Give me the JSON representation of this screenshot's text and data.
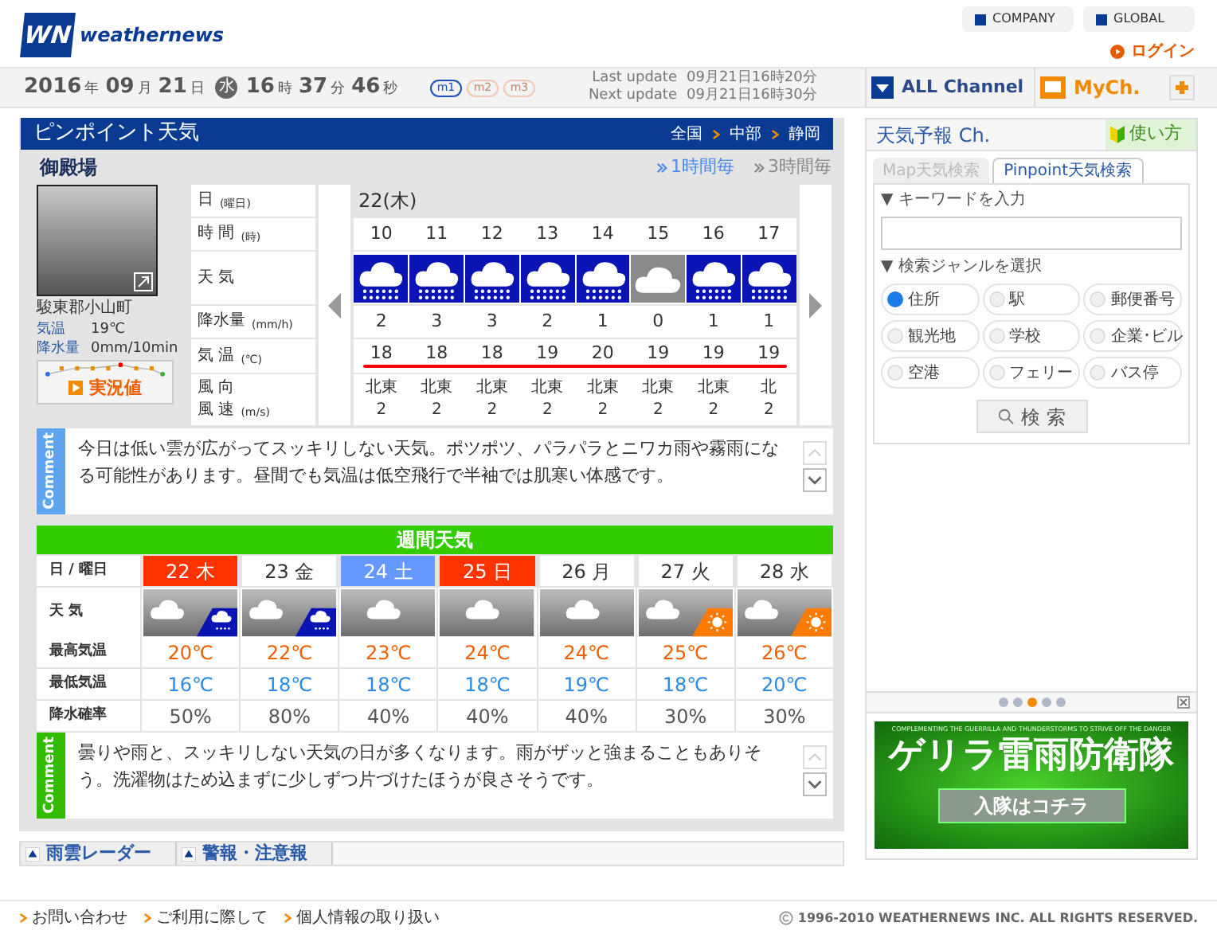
{
  "header": {
    "logo_mark": "WN",
    "logo_text": "weathernews",
    "links": [
      "COMPANY",
      "GLOBAL"
    ],
    "login": "ログイン"
  },
  "clock": {
    "parts": [
      {
        "kind": "num",
        "text": "2016"
      },
      {
        "kind": "unit",
        "text": "年"
      },
      {
        "kind": "num",
        "text": "09"
      },
      {
        "kind": "unit",
        "text": "月"
      },
      {
        "kind": "num",
        "text": "21"
      },
      {
        "kind": "unit",
        "text": "日"
      },
      {
        "kind": "badge",
        "text": "水"
      },
      {
        "kind": "num",
        "text": "16"
      },
      {
        "kind": "unit",
        "text": "時"
      },
      {
        "kind": "num",
        "text": "37"
      },
      {
        "kind": "unit",
        "text": "分"
      },
      {
        "kind": "num",
        "text": "46"
      },
      {
        "kind": "unit",
        "text": "秒"
      }
    ],
    "modes": [
      {
        "label": "m1",
        "selected": true
      },
      {
        "label": "m2",
        "selected": false
      },
      {
        "label": "m3",
        "selected": false
      }
    ]
  },
  "updates": [
    {
      "label": "Last update",
      "value": "09月21日16時20分"
    },
    {
      "label": "Next update",
      "value": "09月21日16時30分"
    }
  ],
  "channels": {
    "all": "ALL Channel",
    "my": "MyCh."
  },
  "pinpoint": {
    "title": "ピンポイント天気",
    "breadcrumb": [
      "全国",
      "中部",
      "静岡"
    ],
    "location": "御殿場",
    "periods": [
      {
        "label": "1時間毎",
        "selected": true
      },
      {
        "label": "3時間毎",
        "selected": false
      }
    ],
    "camera": {
      "place": "駿東郡小山町",
      "readings": [
        {
          "label": "気温",
          "value": "19℃"
        },
        {
          "label": "降水量",
          "value": "0mm/10min"
        }
      ],
      "button": "実況値"
    },
    "hourly": {
      "row_labels": [
        {
          "lines": [
            "日"
          ],
          "unit": "(曜日)"
        },
        {
          "lines": [
            "時 間"
          ],
          "unit": "(時)"
        },
        {
          "lines": [
            "天 気"
          ]
        },
        {
          "lines": [
            "降水量"
          ],
          "unit": "(mm/h)"
        },
        {
          "lines": [
            "気 温"
          ],
          "unit": "(℃)"
        },
        {
          "lines": [
            "風 向",
            "風 速"
          ],
          "unit": "(m/s)"
        }
      ],
      "date": "22(木)",
      "hours": [
        {
          "time": "10",
          "kind": "rain",
          "precip": "2",
          "temp": "18",
          "wind_dir": "北東",
          "wind_speed": "2"
        },
        {
          "time": "11",
          "kind": "rain",
          "precip": "3",
          "temp": "18",
          "wind_dir": "北東",
          "wind_speed": "2"
        },
        {
          "time": "12",
          "kind": "rain",
          "precip": "3",
          "temp": "18",
          "wind_dir": "北東",
          "wind_speed": "2"
        },
        {
          "time": "13",
          "kind": "rain",
          "precip": "2",
          "temp": "19",
          "wind_dir": "北東",
          "wind_speed": "2"
        },
        {
          "time": "14",
          "kind": "rain",
          "precip": "1",
          "temp": "20",
          "wind_dir": "北東",
          "wind_speed": "2"
        },
        {
          "time": "15",
          "kind": "cloudy",
          "precip": "0",
          "temp": "19",
          "wind_dir": "北東",
          "wind_speed": "2"
        },
        {
          "time": "16",
          "kind": "rain",
          "precip": "1",
          "temp": "19",
          "wind_dir": "北東",
          "wind_speed": "2"
        },
        {
          "time": "17",
          "kind": "rain",
          "precip": "1",
          "temp": "19",
          "wind_dir": "北",
          "wind_speed": "2"
        }
      ]
    },
    "comment": {
      "tag": "Comment",
      "text": "今日は低い雲が広がってスッキリしない天気。ポツポツ、パラパラとニワカ雨や霧雨になる可能性があります。昼間でも気温は低空飛行で半袖では肌寒い体感です。"
    }
  },
  "weekly": {
    "title": "週間天気",
    "row_labels": [
      "日 / 曜日",
      "天 気",
      "最高気温",
      "最低気温",
      "降水確率"
    ],
    "days": [
      {
        "day": "22 木",
        "color": "#ff3300",
        "kind": "cloudy-rain",
        "high": "20℃",
        "low": "16℃",
        "pop": "50%"
      },
      {
        "day": "23 金",
        "kind": "cloudy-rain",
        "high": "22℃",
        "low": "18℃",
        "pop": "80%"
      },
      {
        "day": "24 土",
        "color": "#6699ff",
        "kind": "cloudy",
        "high": "23℃",
        "low": "18℃",
        "pop": "40%"
      },
      {
        "day": "25 日",
        "color": "#ff3300",
        "kind": "cloudy",
        "high": "24℃",
        "low": "18℃",
        "pop": "40%"
      },
      {
        "day": "26 月",
        "kind": "cloudy",
        "high": "24℃",
        "low": "19℃",
        "pop": "40%"
      },
      {
        "day": "27 火",
        "kind": "cloudy-sun",
        "high": "25℃",
        "low": "18℃",
        "pop": "30%"
      },
      {
        "day": "28 水",
        "kind": "cloudy-sun",
        "high": "26℃",
        "low": "20℃",
        "pop": "30%"
      }
    ],
    "comment": {
      "tag": "Comment",
      "text": "曇りや雨と、スッキリしない天気の日が多くなります。雨がザッと強まることもありそう。洗濯物はため込まずに少しずつ片づけたほうが良さそうです。"
    }
  },
  "bottom_tabs": [
    "雨雲レーダー",
    "警報・注意報"
  ],
  "sidebar": {
    "title": "天気予報 Ch.",
    "help": "使い方",
    "tabs": [
      {
        "label": "Map天気検索",
        "selected": false
      },
      {
        "label": "Pinpoint天気検索",
        "selected": true
      }
    ],
    "keyword_label": "▼ キーワードを入力",
    "genre_label": "▼ 検索ジャンルを選択",
    "genres": [
      {
        "label": "住所",
        "selected": true
      },
      {
        "label": "駅",
        "selected": false
      },
      {
        "label": "郵便番号",
        "selected": false
      },
      {
        "label": "観光地",
        "selected": false
      },
      {
        "label": "学校",
        "selected": false
      },
      {
        "label": "企業･ビル",
        "selected": false
      },
      {
        "label": "空港",
        "selected": false
      },
      {
        "label": "フェリー",
        "selected": false
      },
      {
        "label": "バス停",
        "selected": false
      }
    ],
    "search_button": "検 索",
    "dots": [
      {
        "selected": false
      },
      {
        "selected": false
      },
      {
        "selected": true
      },
      {
        "selected": false
      },
      {
        "selected": false
      }
    ],
    "banner": {
      "tagline": "COMPLEMENTING THE GUERRILLA AND THUNDERSTORMS TO STRIVE OFF THE DANGER",
      "title": "ゲリラ雷雨防衛隊",
      "button": "入隊はコチラ"
    }
  },
  "footer": {
    "links": [
      "お問い合わせ",
      "ご利用に際して",
      "個人情報の取り扱い"
    ],
    "copyright": "1996-2010 WEATHERNEWS INC. ALL RIGHTS RESERVED."
  }
}
